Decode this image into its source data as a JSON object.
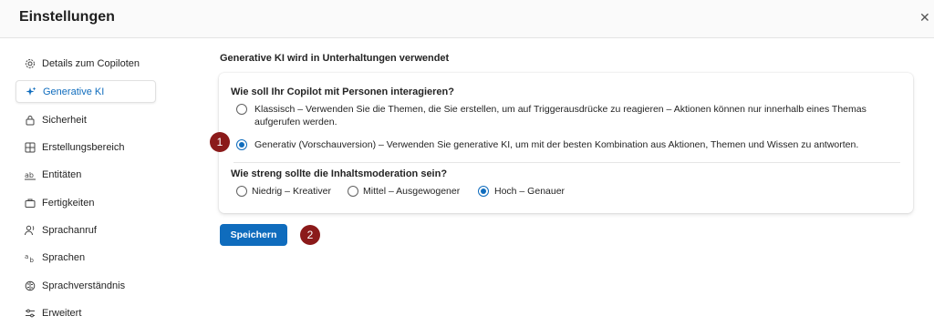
{
  "window": {
    "title": "Einstellungen",
    "close_symbol": "✕"
  },
  "sidebar": {
    "items": [
      {
        "label": "Details zum Copiloten",
        "icon": "gear-icon",
        "active": false
      },
      {
        "label": "Generative KI",
        "icon": "sparkle-icon",
        "active": true
      },
      {
        "label": "Sicherheit",
        "icon": "lock-icon",
        "active": false
      },
      {
        "label": "Erstellungsbereich",
        "icon": "grid-icon",
        "active": false
      },
      {
        "label": "Entitäten",
        "icon": "text-ab-icon",
        "active": false
      },
      {
        "label": "Fertigkeiten",
        "icon": "briefcase-icon",
        "active": false
      },
      {
        "label": "Sprachanruf",
        "icon": "person-voice-icon",
        "active": false
      },
      {
        "label": "Sprachen",
        "icon": "translate-icon",
        "active": false
      },
      {
        "label": "Sprachverständnis",
        "icon": "brain-icon",
        "active": false
      },
      {
        "label": "Erweitert",
        "icon": "sliders-icon",
        "active": false
      }
    ]
  },
  "main": {
    "heading": "Generative KI wird in Unterhaltungen verwendet",
    "interaction_question": "Wie soll Ihr Copilot mit Personen interagieren?",
    "interaction_options": [
      {
        "line1": "Klassisch – Verwenden Sie die Themen, die Sie erstellen, um auf Triggerausdrücke zu reagieren – Aktionen können nur innerhalb eines Themas",
        "line2": "aufgerufen werden.",
        "selected": false
      },
      {
        "line1": "Generativ (Vorschauversion) – Verwenden Sie generative KI, um mit der besten Kombination aus Aktionen, Themen und Wissen zu antworten.",
        "selected": true
      }
    ],
    "moderation_question": "Wie streng sollte die Inhaltsmoderation sein?",
    "moderation_options": [
      {
        "label": "Niedrig – Kreativer",
        "selected": false
      },
      {
        "label": "Mittel – Ausgewogener",
        "selected": false
      },
      {
        "label": "Hoch – Genauer",
        "selected": true
      }
    ],
    "save_label": "Speichern"
  },
  "annotations": {
    "badge1": "1",
    "badge2": "2"
  },
  "colors": {
    "accent": "#0f6cbd",
    "badge": "#8b1a1a"
  }
}
